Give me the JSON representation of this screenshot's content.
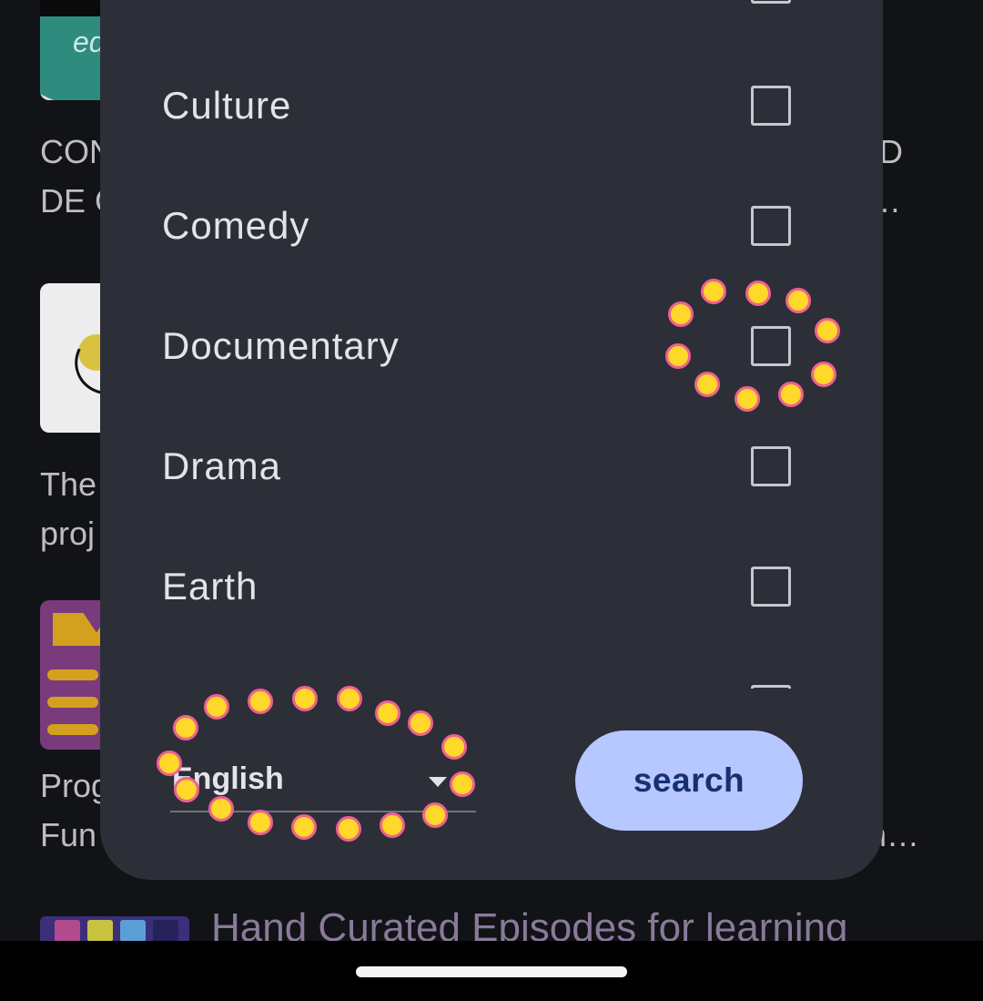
{
  "background": {
    "thumb1_text": "ed",
    "item1_title": [
      "CON",
      "DE C"
    ],
    "item1_title_right": [
      "D",
      "…"
    ],
    "item2_title": [
      "The",
      "proj"
    ],
    "item3_title": [
      "Prog",
      "Fun"
    ],
    "item3_title_right": [
      "n…"
    ],
    "bottom_title": "Hand Curated Episodes for learning"
  },
  "dialog": {
    "categories": [
      {
        "label": "Culture",
        "checked": false
      },
      {
        "label": "Comedy",
        "checked": false
      },
      {
        "label": "Documentary",
        "checked": false
      },
      {
        "label": "Drama",
        "checked": false
      },
      {
        "label": "Earth",
        "checked": false
      }
    ],
    "language_value": "English",
    "search_label": "search"
  },
  "colors": {
    "dialog_bg": "#2d2f38",
    "button_bg": "#b7c7ff",
    "button_text": "#173071",
    "marker_fill": "#ffd829",
    "marker_border": "#f0628e"
  }
}
